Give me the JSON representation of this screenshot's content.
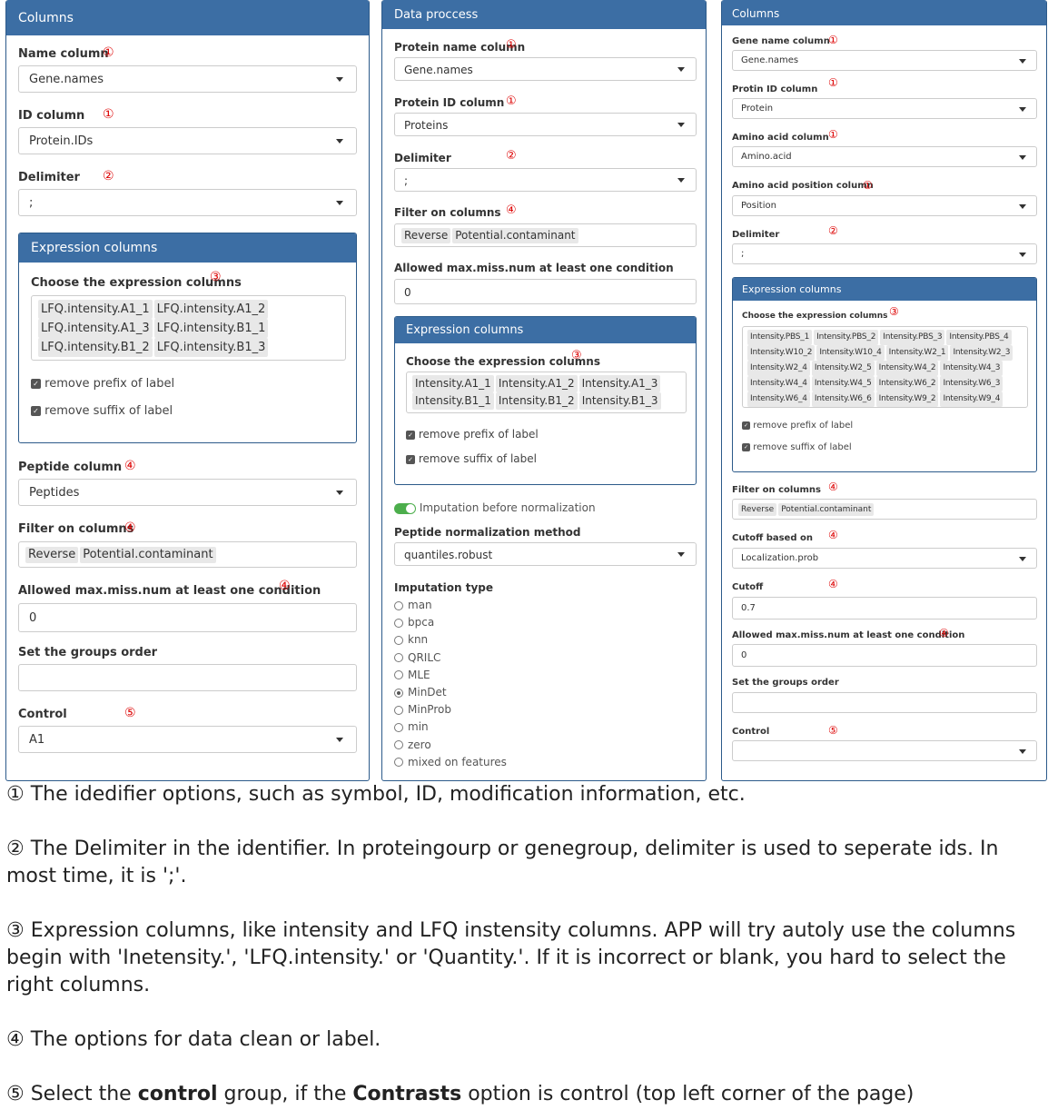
{
  "p1": {
    "title": "Columns",
    "name_label": "Name column",
    "name_value": "Gene.names",
    "id_label": "ID column",
    "id_value": "Protein.IDs",
    "delim_label": "Delimiter",
    "delim_value": ";",
    "expr_title": "Expression columns",
    "expr_label": "Choose the expression columns",
    "chips": [
      "LFQ.intensity.A1_1",
      "LFQ.intensity.A1_2",
      "LFQ.intensity.A1_3",
      "LFQ.intensity.B1_1",
      "LFQ.intensity.B1_2",
      "LFQ.intensity.B1_3"
    ],
    "prefix": "remove prefix of label",
    "suffix": "remove suffix of label",
    "pep_label": "Peptide column",
    "pep_value": "Peptides",
    "filter_label": "Filter on columns",
    "filter_chips": [
      "Reverse",
      "Potential.contaminant"
    ],
    "miss_label": "Allowed max.miss.num at least one condition",
    "miss_value": "0",
    "groups_label": "Set the groups order",
    "control_label": "Control",
    "control_value": "A1"
  },
  "p2": {
    "title": "Data proccess",
    "pname_label": "Protein name column",
    "pname_value": "Gene.names",
    "pid_label": "Protein ID column",
    "pid_value": "Proteins",
    "delim_label": "Delimiter",
    "delim_value": ";",
    "filter_label": "Filter on columns",
    "filter_chips": [
      "Reverse",
      "Potential.contaminant"
    ],
    "miss_label": "Allowed max.miss.num at least one condition",
    "miss_value": "0",
    "expr_title": "Expression columns",
    "expr_label": "Choose the expression columns",
    "chips": [
      "Intensity.A1_1",
      "Intensity.A1_2",
      "Intensity.A1_3",
      "Intensity.B1_1",
      "Intensity.B1_2",
      "Intensity.B1_3"
    ],
    "prefix": "remove prefix of label",
    "suffix": "remove suffix of label",
    "imput_toggle": "Imputation before normalization",
    "norm_label": "Peptide normalization method",
    "norm_value": "quantiles.robust",
    "imput_label": "Imputation type",
    "imput_options": [
      "man",
      "bpca",
      "knn",
      "QRILC",
      "MLE",
      "MinDet",
      "MinProb",
      "min",
      "zero",
      "mixed on features"
    ],
    "imput_selected": "MinDet"
  },
  "p3": {
    "title": "Columns",
    "gname_label": "Gene name column",
    "gname_value": "Gene.names",
    "pid_label": "Protin ID column",
    "pid_value": "Protein",
    "aa_label": "Amino acid column",
    "aa_value": "Amino.acid",
    "aap_label": "Amino acid position column",
    "aap_value": "Position",
    "delim_label": "Delimiter",
    "delim_value": ";",
    "expr_title": "Expression columns",
    "expr_label": "Choose the expression columns",
    "chips": [
      "Intensity.PBS_1",
      "Intensity.PBS_2",
      "Intensity.PBS_3",
      "Intensity.PBS_4",
      "Intensity.W10_2",
      "Intensity.W10_4",
      "Intensity.W2_1",
      "Intensity.W2_3",
      "Intensity.W2_4",
      "Intensity.W2_5",
      "Intensity.W4_2",
      "Intensity.W4_3",
      "Intensity.W4_4",
      "Intensity.W4_5",
      "Intensity.W6_2",
      "Intensity.W6_3",
      "Intensity.W6_4",
      "Intensity.W6_6",
      "Intensity.W9_2",
      "Intensity.W9_4"
    ],
    "prefix": "remove prefix of label",
    "suffix": "remove suffix of label",
    "filter_label": "Filter on columns",
    "filter_chips": [
      "Reverse",
      "Potential.contaminant"
    ],
    "cutoffb_label": "Cutoff based on",
    "cutoffb_value": "Localization.prob",
    "cutoff_label": "Cutoff",
    "cutoff_value": "0.7",
    "miss_label": "Allowed max.miss.num at least one condition",
    "miss_value": "0",
    "groups_label": "Set the groups order",
    "control_label": "Control"
  },
  "marks": {
    "m1": "①",
    "m2": "②",
    "m3": "③",
    "m4": "④",
    "m5": "⑤"
  },
  "notes": {
    "n1": "① The idedifier options, such as symbol, ID, modification information, etc.",
    "n2": "② The Delimiter in the identifier. In proteingourp or genegroup, delimiter is used to seperate ids. In most time, it is ';'.",
    "n3": "③ Expression columns, like intensity and LFQ instensity columns. APP will try autoly use the columns begin with 'Inetensity.', 'LFQ.intensity.' or 'Quantity.'. If it is  incorrect or blank, you hard to select the right columns.",
    "n4": "④ The options for data clean or label.",
    "n5_a": "⑤ Select the ",
    "n5_b": "control",
    "n5_c": " group, if the ",
    "n5_d": "Contrasts",
    "n5_e": " option is control (top left corner of the page)"
  }
}
